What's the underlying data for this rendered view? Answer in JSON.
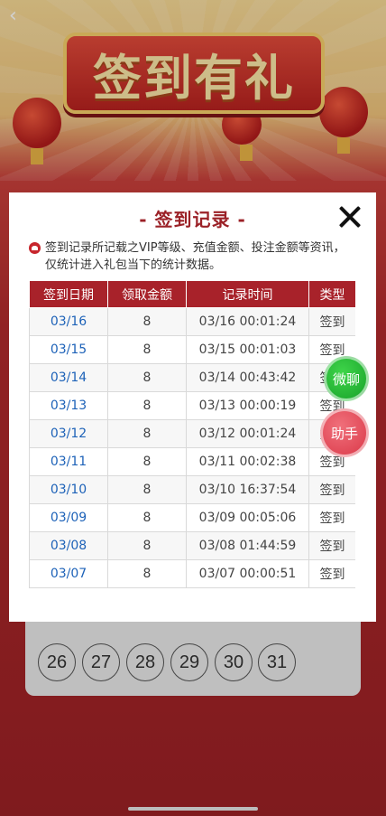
{
  "header": {
    "back_icon": "chevron-left-icon"
  },
  "banner": {
    "title": "签到有礼"
  },
  "calendar": {
    "days": [
      "26",
      "27",
      "28",
      "29",
      "30",
      "31"
    ]
  },
  "modal": {
    "title": "- 签到记录 -",
    "close_icon": "close-icon",
    "notice_icon": "heart-icon",
    "notice": "签到记录所记载之VIP等级、充值金额、投注金额等资讯，仅统计进入礼包当下的统计数据。",
    "table": {
      "headers": [
        "签到日期",
        "领取金额",
        "记录时间",
        "类型"
      ],
      "rows": [
        [
          "03/16",
          "8",
          "03/16 00:01:24",
          "签到"
        ],
        [
          "03/15",
          "8",
          "03/15 00:01:03",
          "签到"
        ],
        [
          "03/14",
          "8",
          "03/14 00:43:42",
          "签到"
        ],
        [
          "03/13",
          "8",
          "03/13 00:00:19",
          "签到"
        ],
        [
          "03/12",
          "8",
          "03/12 00:01:24",
          "签到"
        ],
        [
          "03/11",
          "8",
          "03/11 00:02:38",
          "签到"
        ],
        [
          "03/10",
          "8",
          "03/10 16:37:54",
          "签到"
        ],
        [
          "03/09",
          "8",
          "03/09 00:05:06",
          "签到"
        ],
        [
          "03/08",
          "8",
          "03/08 01:44:59",
          "签到"
        ],
        [
          "03/07",
          "8",
          "03/07 00:00:51",
          "签到"
        ]
      ]
    }
  },
  "floating": {
    "wechat_label": "微聊",
    "assistant_label": "助手"
  },
  "colors": {
    "accent": "#a8222a",
    "date_link": "#1d62b8",
    "wechat": "#2bbf3a",
    "assistant": "#e14a58"
  }
}
